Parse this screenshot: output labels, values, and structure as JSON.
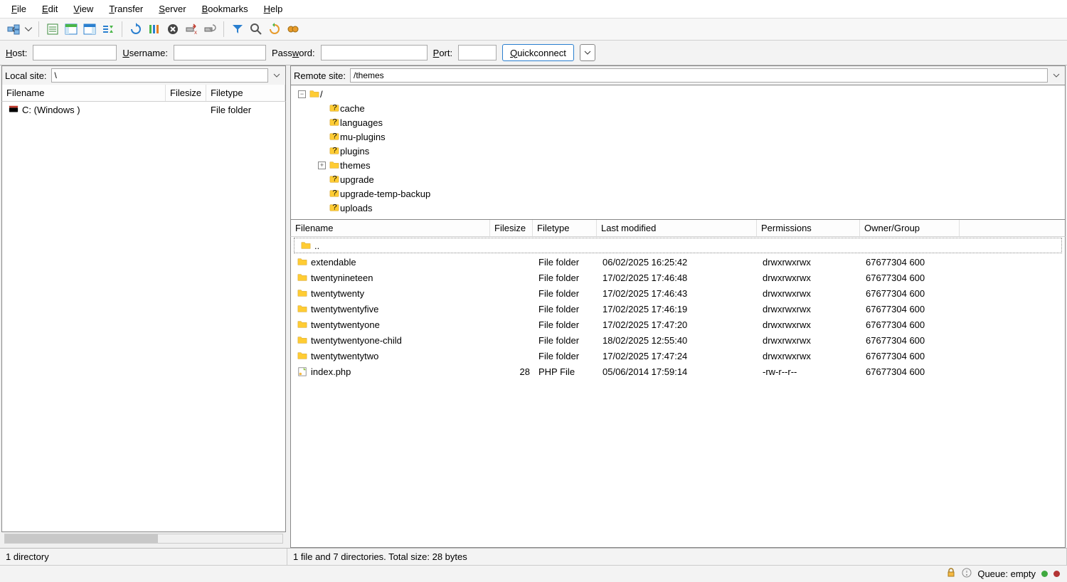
{
  "menu": {
    "file": "File",
    "edit": "Edit",
    "view": "View",
    "transfer": "Transfer",
    "server": "Server",
    "bookmarks": "Bookmarks",
    "help": "Help"
  },
  "quickconnect": {
    "host": "Host:",
    "user": "Username:",
    "pass": "Password:",
    "port": "Port:",
    "btn": "Quickconnect"
  },
  "local": {
    "label": "Local site:",
    "path": "\\",
    "headers": {
      "name": "Filename",
      "size": "Filesize",
      "type": "Filetype"
    },
    "rows": [
      {
        "icon": "drive",
        "name": "C: (Windows )",
        "size": "",
        "type": "File folder"
      }
    ],
    "status": "1 directory"
  },
  "remote": {
    "label": "Remote site:",
    "path": "/themes",
    "tree": [
      {
        "depth": 0,
        "expander": "-",
        "icon": "folder",
        "name": "/"
      },
      {
        "depth": 1,
        "expander": "",
        "icon": "folder-q",
        "name": "cache"
      },
      {
        "depth": 1,
        "expander": "",
        "icon": "folder-q",
        "name": "languages"
      },
      {
        "depth": 1,
        "expander": "",
        "icon": "folder-q",
        "name": "mu-plugins"
      },
      {
        "depth": 1,
        "expander": "",
        "icon": "folder-q",
        "name": "plugins"
      },
      {
        "depth": 1,
        "expander": "+",
        "icon": "folder",
        "name": "themes"
      },
      {
        "depth": 1,
        "expander": "",
        "icon": "folder-q",
        "name": "upgrade"
      },
      {
        "depth": 1,
        "expander": "",
        "icon": "folder-q",
        "name": "upgrade-temp-backup"
      },
      {
        "depth": 1,
        "expander": "",
        "icon": "folder-q",
        "name": "uploads"
      }
    ],
    "headers": {
      "name": "Filename",
      "size": "Filesize",
      "type": "Filetype",
      "mod": "Last modified",
      "perm": "Permissions",
      "own": "Owner/Group"
    },
    "parent": "..",
    "rows": [
      {
        "icon": "folder",
        "name": "extendable",
        "size": "",
        "type": "File folder",
        "mod": "06/02/2025 16:25:42",
        "perm": "drwxrwxrwx",
        "own": "67677304 600"
      },
      {
        "icon": "folder",
        "name": "twentynineteen",
        "size": "",
        "type": "File folder",
        "mod": "17/02/2025 17:46:48",
        "perm": "drwxrwxrwx",
        "own": "67677304 600"
      },
      {
        "icon": "folder",
        "name": "twentytwenty",
        "size": "",
        "type": "File folder",
        "mod": "17/02/2025 17:46:43",
        "perm": "drwxrwxrwx",
        "own": "67677304 600"
      },
      {
        "icon": "folder",
        "name": "twentytwentyfive",
        "size": "",
        "type": "File folder",
        "mod": "17/02/2025 17:46:19",
        "perm": "drwxrwxrwx",
        "own": "67677304 600"
      },
      {
        "icon": "folder",
        "name": "twentytwentyone",
        "size": "",
        "type": "File folder",
        "mod": "17/02/2025 17:47:20",
        "perm": "drwxrwxrwx",
        "own": "67677304 600"
      },
      {
        "icon": "folder",
        "name": "twentytwentyone-child",
        "size": "",
        "type": "File folder",
        "mod": "18/02/2025 12:55:40",
        "perm": "drwxrwxrwx",
        "own": "67677304 600"
      },
      {
        "icon": "folder",
        "name": "twentytwentytwo",
        "size": "",
        "type": "File folder",
        "mod": "17/02/2025 17:47:24",
        "perm": "drwxrwxrwx",
        "own": "67677304 600"
      },
      {
        "icon": "php",
        "name": "index.php",
        "size": "28",
        "type": "PHP File",
        "mod": "05/06/2014 17:59:14",
        "perm": "-rw-r--r--",
        "own": "67677304 600"
      }
    ],
    "status": "1 file and 7 directories. Total size: 28 bytes"
  },
  "bottom": {
    "queue": "Queue: empty"
  }
}
